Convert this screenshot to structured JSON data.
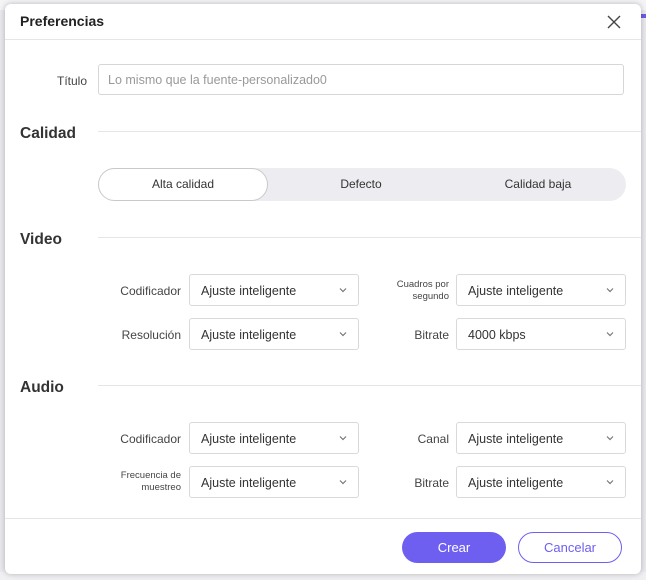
{
  "dialog": {
    "title": "Preferencias"
  },
  "title_field": {
    "label": "Título",
    "value": "Lo mismo que la fuente-personalizado0"
  },
  "quality": {
    "heading": "Calidad",
    "options": [
      "Alta calidad",
      "Defecto",
      "Calidad baja"
    ],
    "selected": "Alta calidad"
  },
  "video": {
    "heading": "Video",
    "encoder": {
      "label": "Codificador",
      "value": "Ajuste inteligente"
    },
    "fps": {
      "label_line1": "Cuadros por",
      "label_line2": "segundo",
      "value": "Ajuste inteligente"
    },
    "resolution": {
      "label": "Resolución",
      "value": "Ajuste inteligente"
    },
    "bitrate": {
      "label": "Bitrate",
      "value": "4000 kbps"
    }
  },
  "audio": {
    "heading": "Audio",
    "encoder": {
      "label": "Codificador",
      "value": "Ajuste inteligente"
    },
    "channel": {
      "label": "Canal",
      "value": "Ajuste inteligente"
    },
    "sample_rate": {
      "label_line1": "Frecuencia de",
      "label_line2": "muestreo",
      "value": "Ajuste inteligente"
    },
    "bitrate": {
      "label": "Bitrate",
      "value": "Ajuste inteligente"
    }
  },
  "buttons": {
    "create": "Crear",
    "cancel": "Cancelar"
  },
  "colors": {
    "accent": "#6e5ff0",
    "background": "#e9e9ee"
  },
  "icons": {
    "close": "close-icon",
    "dropdown": "chevron-down-icon"
  }
}
